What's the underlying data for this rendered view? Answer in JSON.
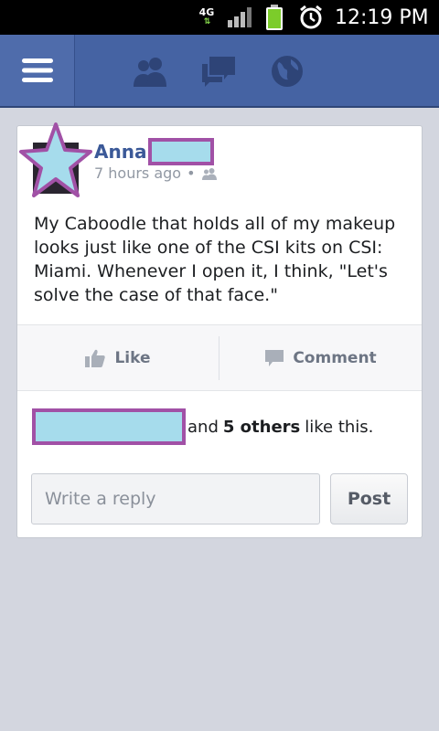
{
  "status_bar": {
    "network": "4G",
    "time": "12:19 PM",
    "icons": [
      "network-4g-icon",
      "signal-icon",
      "battery-icon",
      "alarm-icon"
    ]
  },
  "top_nav": {
    "icons": [
      "menu-icon",
      "friends-icon",
      "messages-icon",
      "globe-icon"
    ]
  },
  "post": {
    "author": "Anna",
    "time": "7 hours ago",
    "separator": "•",
    "audience_icon": "friends-audience-icon",
    "text": "My Caboodle that holds all of my makeup looks just like one of the CSI kits on CSI: Miami. Whenever I open it, I think, \"Let's solve the case of  that face.\"",
    "actions": {
      "like": "Like",
      "comment": "Comment"
    },
    "likes": {
      "prefix": "and",
      "count": "5 others",
      "suffix": "like this."
    },
    "reply": {
      "placeholder": "Write a reply",
      "button": "Post"
    }
  },
  "colors": {
    "nav_bar": "#4563a3",
    "author_link": "#3b5998",
    "redaction_fill": "#a6dcec",
    "redaction_border": "#a151a6"
  }
}
